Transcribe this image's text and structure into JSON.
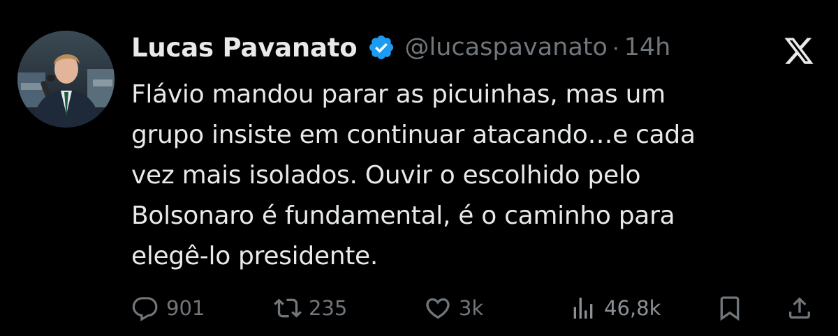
{
  "author": {
    "display_name": "Lucas Pavanato",
    "handle": "@lucaspavanato",
    "separator": "·",
    "time": "14h",
    "verified_icon": "verified-badge-icon",
    "avatar_icon": "profile-photo"
  },
  "platform": {
    "logo_icon": "x-logo-icon"
  },
  "tweet": {
    "text": "Flávio mandou parar as picuinhas, mas um\ngrupo insiste em continuar atacando…e cada\nvez mais isolados. Ouvir o escolhido pelo\nBolsonaro é fundamental, é o caminho para\nelegê-lo presidente."
  },
  "actions": {
    "replies": "901",
    "reposts": "235",
    "likes": "3k",
    "views": "46,8k"
  },
  "colors": {
    "background": "#000000",
    "text": "#e7e9ea",
    "muted": "#71767b",
    "verified": "#1d9bf0"
  }
}
